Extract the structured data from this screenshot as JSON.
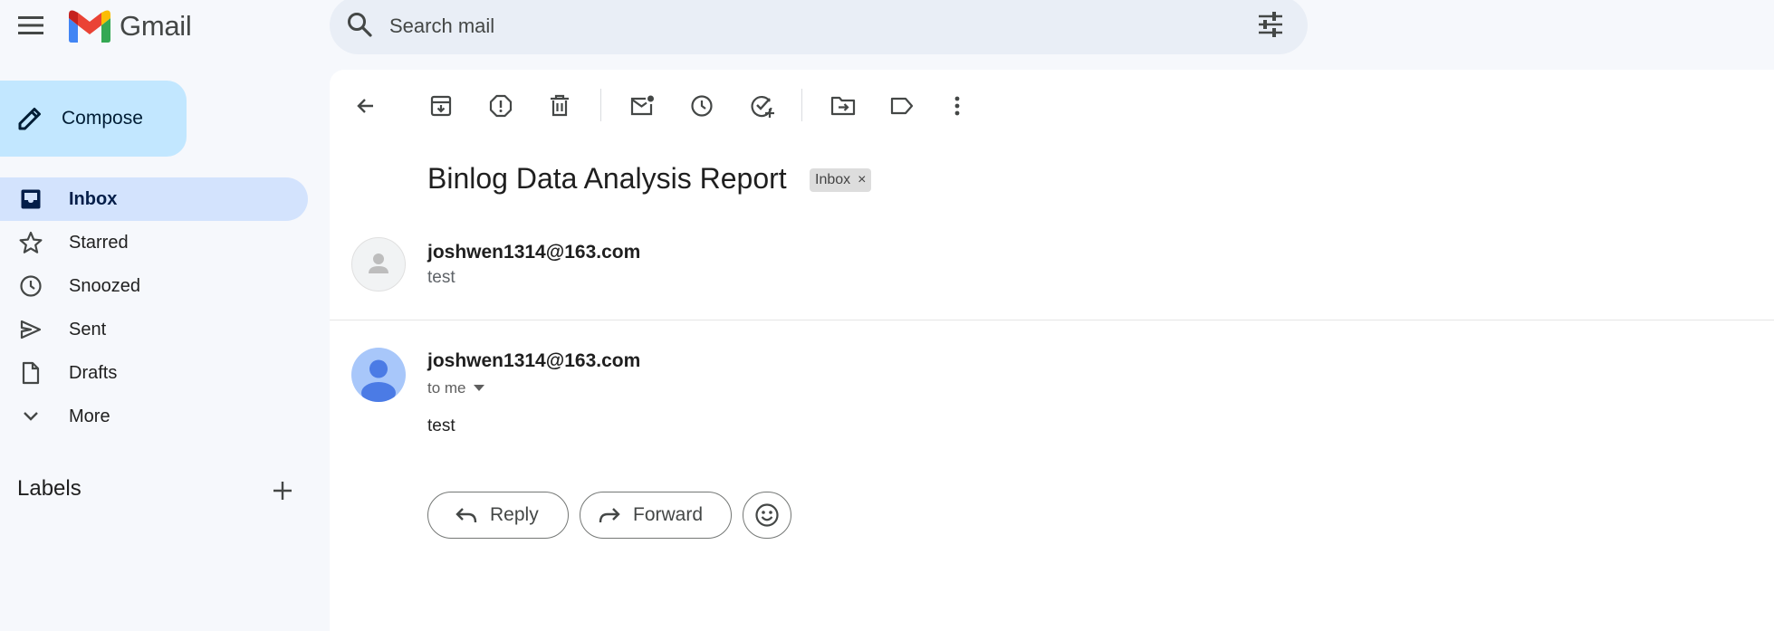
{
  "app": {
    "name": "Gmail"
  },
  "search": {
    "placeholder": "Search mail"
  },
  "compose": {
    "label": "Compose"
  },
  "sidebar": {
    "items": [
      {
        "label": "Inbox",
        "icon": "inbox-icon",
        "active": true
      },
      {
        "label": "Starred",
        "icon": "star-icon"
      },
      {
        "label": "Snoozed",
        "icon": "clock-icon"
      },
      {
        "label": "Sent",
        "icon": "send-icon"
      },
      {
        "label": "Drafts",
        "icon": "draft-icon"
      },
      {
        "label": "More",
        "icon": "chevron-down-icon"
      }
    ],
    "labels_heading": "Labels"
  },
  "toolbar": {
    "icons": [
      "back-arrow-icon",
      "archive-icon",
      "report-spam-icon",
      "delete-icon",
      "mark-unread-icon",
      "snooze-icon",
      "add-to-tasks-icon",
      "move-to-icon",
      "label-icon",
      "more-vert-icon"
    ]
  },
  "email": {
    "subject": "Binlog Data Analysis Report",
    "label_chip": "Inbox",
    "label_chip_close": "×",
    "collapsed_message": {
      "sender": "joshwen1314@163.com",
      "snippet": "test"
    },
    "message": {
      "sender": "joshwen1314@163.com",
      "recipient": "to me",
      "body": "test"
    },
    "actions": {
      "reply": "Reply",
      "forward": "Forward"
    }
  },
  "colors": {
    "background": "#f6f8fc",
    "compose": "#c2e7ff",
    "active_nav": "#d3e3fd",
    "search": "#e9eef6",
    "avatar": "#a8c7fa",
    "avatar_figure": "#4b7be5"
  }
}
